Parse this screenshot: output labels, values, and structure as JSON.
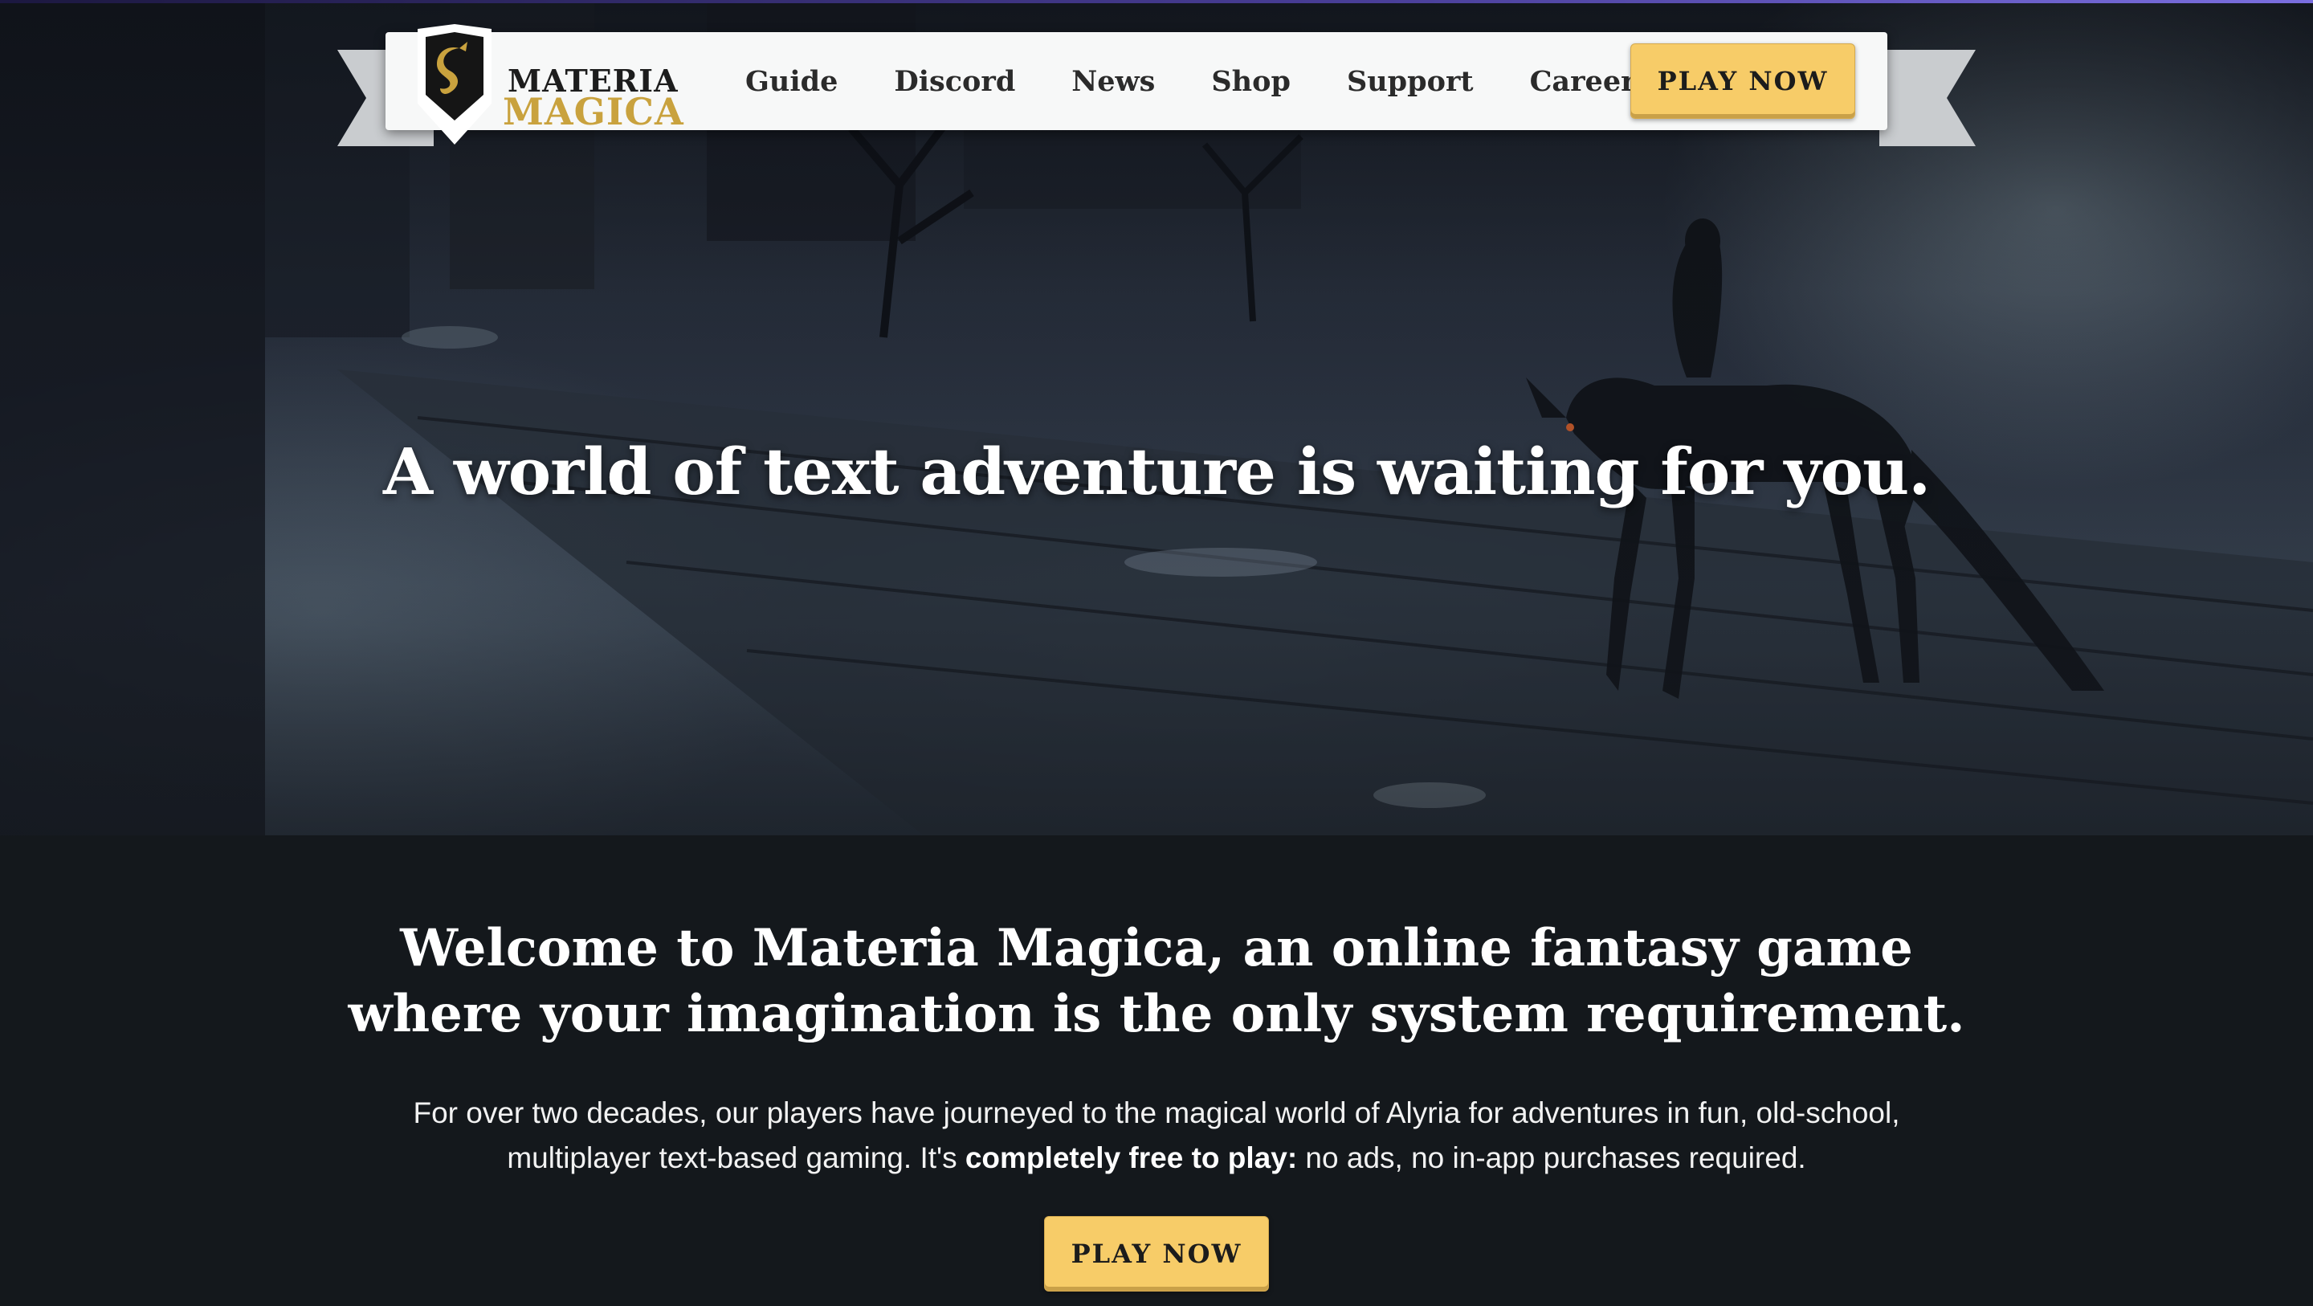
{
  "brand": {
    "name_line1": "MATERIA",
    "name_line2": "MAGICA",
    "gold_color": "#c9a23e"
  },
  "nav": {
    "links": [
      "Guide",
      "Discord",
      "News",
      "Shop",
      "Support",
      "Careers"
    ],
    "cta_label": "PLAY NOW"
  },
  "hero": {
    "headline": "A world of text adventure is waiting for you."
  },
  "welcome": {
    "title": "Welcome to Materia Magica, an online fantasy game where your imagination is the only system requirement.",
    "body_before": "For over two decades, our players have journeyed to the magical world of Alyria for adventures in fun, old-school, multiplayer text-based gaming. It's ",
    "body_bold": "completely free to play:",
    "body_after": " no ads, no in-app purchases required.",
    "cta_label": "PLAY NOW"
  },
  "colors": {
    "accent_button": "#f7cc68",
    "page_background": "#14181c",
    "nav_background": "#f7f8f8"
  }
}
